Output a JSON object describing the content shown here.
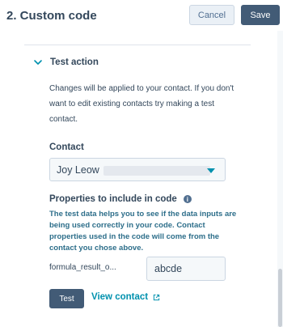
{
  "header": {
    "title": "2. Custom code",
    "cancel_label": "Cancel",
    "save_label": "Save"
  },
  "section": {
    "title": "Test action",
    "description": "Changes will be applied to your contact. If you don't want to edit existing contacts try making a test contact.",
    "expanded": true
  },
  "contact": {
    "label": "Contact",
    "selected_value": "Joy Leow"
  },
  "properties": {
    "label": "Properties to include in code",
    "help_text": "The test data helps you to see if the data inputs are being used correctly in your code. Contact properties used in the code will come from the contact you chose above.",
    "items": [
      {
        "name": "formula_result_o...",
        "value": "abcde"
      }
    ]
  },
  "actions": {
    "test_label": "Test",
    "view_contact_label": "View contact"
  },
  "icons": {
    "section_toggle": "chevron-down-icon",
    "info": "info-icon",
    "external": "external-link-icon",
    "select_caret": "caret-down-icon"
  },
  "colors": {
    "primary_button": "#425b76",
    "link": "#0091ae",
    "help_text": "#2d6e8a",
    "text": "#33475b"
  }
}
